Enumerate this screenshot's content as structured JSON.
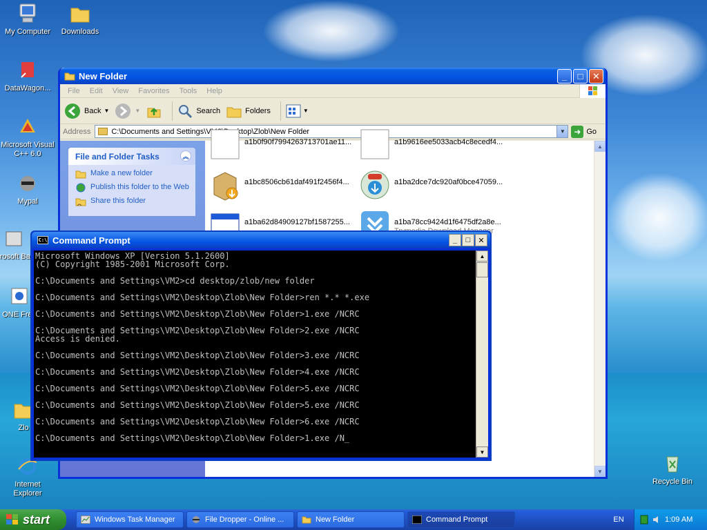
{
  "desktop": {
    "icons": [
      {
        "label": "My Computer"
      },
      {
        "label": "Downloads"
      },
      {
        "label": "DataWagon..."
      },
      {
        "label": "Microsoft Visual C++ 6.0"
      },
      {
        "label": "Mypal"
      },
      {
        "label": "Microsoft Basic"
      },
      {
        "label": "ONE Free"
      },
      {
        "label": "Zlo"
      },
      {
        "label": "Internet Explorer"
      },
      {
        "label": "Recycle Bin"
      }
    ]
  },
  "explorer": {
    "title": "New Folder",
    "menu": [
      "File",
      "Edit",
      "View",
      "Favorites",
      "Tools",
      "Help"
    ],
    "toolbar": {
      "back": "Back",
      "search": "Search",
      "folders": "Folders"
    },
    "address_label": "Address",
    "address_value": "C:\\Documents and Settings\\VM2\\Desktop\\Zlob\\New Folder",
    "go_label": "Go",
    "tasks_title": "File and Folder Tasks",
    "tasks": [
      {
        "label": "Make a new folder"
      },
      {
        "label": "Publish this folder to the Web"
      },
      {
        "label": "Share this folder"
      }
    ],
    "files": [
      {
        "name": "a1b0f90f7994263713701ae11...",
        "sub": ""
      },
      {
        "name": "a1b9616ee5033acb4c8ecedf4...",
        "sub": ""
      },
      {
        "name": "a1bc8506cb61daf491f2456f4...",
        "sub": ""
      },
      {
        "name": "a1ba2dce7dc920af0bce47059...",
        "sub": ""
      },
      {
        "name": "a1ba62d84909127bf1587255...",
        "sub": ""
      },
      {
        "name": "a1ba78cc9424d1f6475df2a8e...",
        "sub": "Trymedia Download Manager"
      }
    ]
  },
  "cmd": {
    "title": "Command Prompt",
    "icon_text": "C:\\",
    "output": "Microsoft Windows XP [Version 5.1.2600]\n(C) Copyright 1985-2001 Microsoft Corp.\n\nC:\\Documents and Settings\\VM2>cd desktop/zlob/new folder\n\nC:\\Documents and Settings\\VM2\\Desktop\\Zlob\\New Folder>ren *.* *.exe\n\nC:\\Documents and Settings\\VM2\\Desktop\\Zlob\\New Folder>1.exe /NCRC\n\nC:\\Documents and Settings\\VM2\\Desktop\\Zlob\\New Folder>2.exe /NCRC\nAccess is denied.\n\nC:\\Documents and Settings\\VM2\\Desktop\\Zlob\\New Folder>3.exe /NCRC\n\nC:\\Documents and Settings\\VM2\\Desktop\\Zlob\\New Folder>4.exe /NCRC\n\nC:\\Documents and Settings\\VM2\\Desktop\\Zlob\\New Folder>5.exe /NCRC\n\nC:\\Documents and Settings\\VM2\\Desktop\\Zlob\\New Folder>5.exe /NCRC\n\nC:\\Documents and Settings\\VM2\\Desktop\\Zlob\\New Folder>6.exe /NCRC\n\nC:\\Documents and Settings\\VM2\\Desktop\\Zlob\\New Folder>1.exe /N_"
  },
  "taskbar": {
    "start_label": "start",
    "tasks": [
      {
        "label": "Windows Task Manager"
      },
      {
        "label": "File Dropper - Online ..."
      },
      {
        "label": "New Folder"
      },
      {
        "label": "Command Prompt"
      }
    ],
    "language": "EN",
    "clock": "1:09 AM"
  },
  "colors": {
    "xp_blue": "#0454e2",
    "start_green": "#2f8f2f",
    "cmd_text": "#c0c0c0"
  }
}
